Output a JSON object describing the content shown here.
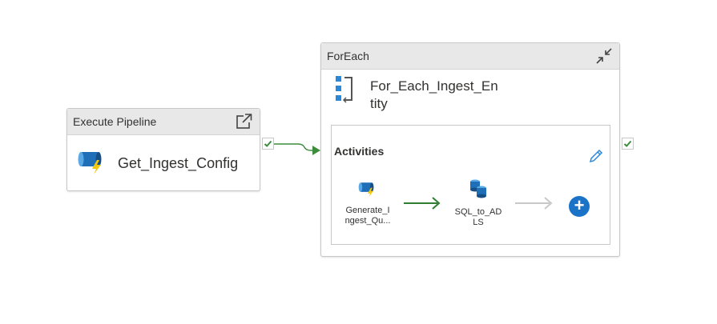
{
  "execute_pipeline": {
    "header": "Execute Pipeline",
    "name": "Get_Ingest_Config",
    "icon": "execute-pipeline-icon",
    "open_icon": "open-external-icon"
  },
  "foreach": {
    "header": "ForEach",
    "name": "For_Each_Ingest_Entity",
    "icon": "foreach-icon",
    "collapse_icon": "collapse-icon",
    "activities": {
      "label": "Activities",
      "edit_icon": "pencil-icon",
      "items": [
        {
          "name": "Generate_Ingest_Qu...",
          "label_line1": "Generate_I",
          "label_line2": "ngest_Qu...",
          "icon": "execute-pipeline-icon"
        },
        {
          "name": "SQL_to_ADLS",
          "label_line1": "SQL_to_AD",
          "label_line2": "LS",
          "icon": "copy-data-icon"
        }
      ],
      "add_icon": "plus-icon",
      "add_symbol": "+"
    }
  },
  "colors": {
    "success_green": "#3d8b3d",
    "pending_gray": "#c8c8c8",
    "accent_blue": "#1b73c8",
    "header_bg": "#e8e8e8"
  }
}
